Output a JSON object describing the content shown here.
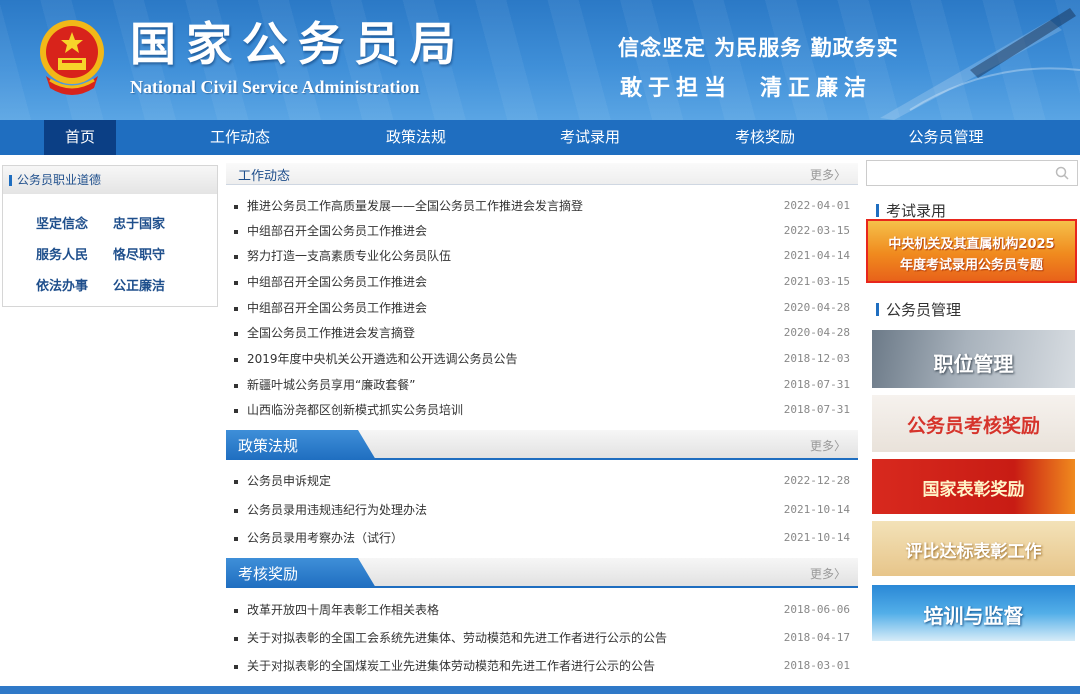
{
  "header": {
    "title": "国家公务员局",
    "subtitle": "National Civil Service Administration",
    "slogan_line1": "信念坚定 为民服务 勤政务实",
    "slogan_line2": "敢于担当　清正廉洁"
  },
  "nav": {
    "items": [
      "首页",
      "工作动态",
      "政策法规",
      "考试录用",
      "考核奖励",
      "公务员管理"
    ],
    "active": "首页"
  },
  "ethics": {
    "title": "公务员职业道德",
    "items": [
      "坚定信念",
      "忠于国家",
      "服务人民",
      "恪尽职守",
      "依法办事",
      "公正廉洁"
    ]
  },
  "work_news": {
    "title": "工作动态",
    "more": "更多〉",
    "items": [
      {
        "title": "推进公务员工作高质量发展——全国公务员工作推进会发言摘登",
        "date": "2022-04-01"
      },
      {
        "title": "中组部召开全国公务员工作推进会",
        "date": "2022-03-15"
      },
      {
        "title": "努力打造一支高素质专业化公务员队伍",
        "date": "2021-04-14"
      },
      {
        "title": "中组部召开全国公务员工作推进会",
        "date": "2021-03-15"
      },
      {
        "title": "中组部召开全国公务员工作推进会",
        "date": "2020-04-28"
      },
      {
        "title": "全国公务员工作推进会发言摘登",
        "date": "2020-04-28"
      },
      {
        "title": "2019年度中央机关公开遴选和公开选调公务员公告",
        "date": "2018-12-03"
      },
      {
        "title": "新疆叶城公务员享用“廉政套餐”",
        "date": "2018-07-31"
      },
      {
        "title": "山西临汾尧都区创新模式抓实公务员培训",
        "date": "2018-07-31"
      }
    ]
  },
  "policy": {
    "title": "政策法规",
    "more": "更多〉",
    "items": [
      {
        "title": "公务员申诉规定",
        "date": "2022-12-28"
      },
      {
        "title": "公务员录用违规违纪行为处理办法",
        "date": "2021-10-14"
      },
      {
        "title": "公务员录用考察办法（试行）",
        "date": "2021-10-14"
      }
    ]
  },
  "reward": {
    "title": "考核奖励",
    "more": "更多〉",
    "items": [
      {
        "title": "改革开放四十周年表彰工作相关表格",
        "date": "2018-06-06"
      },
      {
        "title": "关于对拟表彰的全国工会系统先进集体、劳动模范和先进工作者进行公示的公告",
        "date": "2018-04-17"
      },
      {
        "title": "关于对拟表彰的全国煤炭工业先进集体劳动模范和先进工作者进行公示的公告",
        "date": "2018-03-01"
      }
    ]
  },
  "right": {
    "search_placeholder": "",
    "exam_title": "考试录用",
    "exam_banner_line1": "中央机关及其直属机构2025",
    "exam_banner_line2": "年度考试录用公务员专题",
    "mgmt_title": "公务员管理",
    "banners": [
      "职位管理",
      "公务员考核奖励",
      "国家表彰奖励",
      "评比达标表彰工作",
      "培训与监督"
    ]
  },
  "colors": {
    "primary": "#1f6ec0",
    "nav_active": "#0b3f85",
    "highlight_border": "#e8261c"
  }
}
